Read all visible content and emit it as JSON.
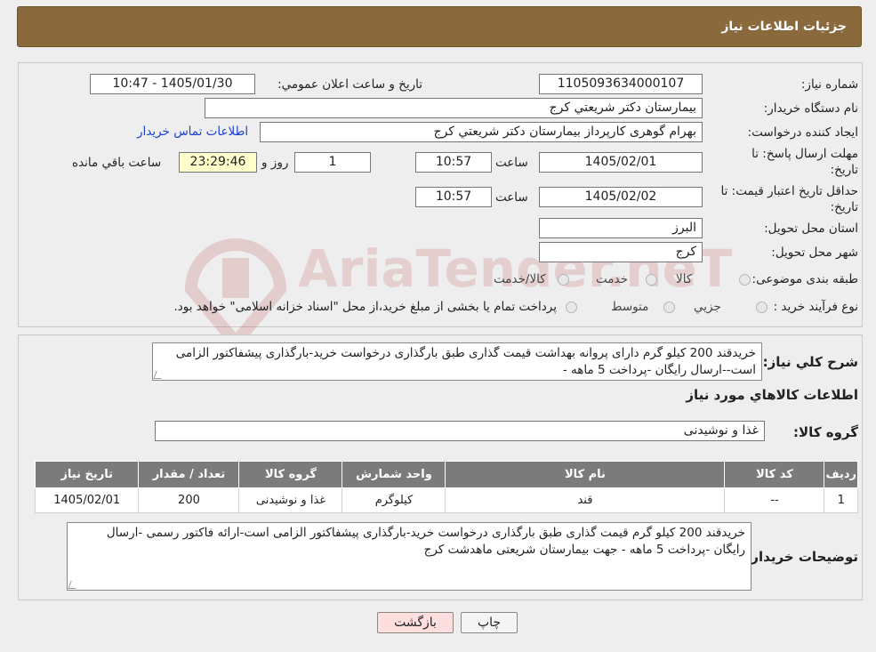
{
  "header": {
    "title": "جزئیات اطلاعات نیاز"
  },
  "form": {
    "need_number_label": "شماره نیاز:",
    "need_number": "1105093634000107",
    "announce_label": "تاریخ و ساعت اعلان عمومي:",
    "announce_value": "1405/01/30 - 10:47",
    "buyer_org_label": "نام دستگاه خريدار:",
    "buyer_org": "بيمارستان دكتر شريعتي كرج",
    "creator_label": "ايجاد كننده درخواست:",
    "creator": "بهرام گوهری کارپرداز بیمارستان دكتر شريعتي كرج",
    "contact_link": "اطلاعات تماس خريدار",
    "deadline_label_1": "مهلت ارسال پاسخ: تا",
    "deadline_label_2": "تاریخ:",
    "deadline_date": "1405/02/01",
    "time_label": "ساعت",
    "deadline_time": "10:57",
    "days_count": "1",
    "days_label": "روز و",
    "remaining_time": "23:29:46",
    "remaining_label": "ساعت باقي مانده",
    "validity_label_1": "حداقل تاريخ اعتبار قيمت: تا",
    "validity_label_2": "تاريخ:",
    "validity_date": "1405/02/02",
    "validity_time": "10:57",
    "province_label": "استان محل تحويل:",
    "province": "البرز",
    "city_label": "شهر محل تحويل:",
    "city": "كرج",
    "category_label": "طبقه بندی موضوعی:",
    "category_options": [
      "كالا",
      "خدمت",
      "كالا/خدمت"
    ],
    "process_label": "نوع فرآيند خريد :",
    "process_options": [
      "جزيي",
      "متوسط"
    ],
    "process_note": "پرداخت تمام یا بخشی از مبلغ خرید،از محل \"اسناد خزانه اسلامی\" خواهد بود."
  },
  "summary": {
    "label": "شرح كلي نياز:",
    "text": "خریدقند 200 کیلو گرم دارای پروانه بهداشت قیمت گذاری طبق بارگذاری درخواست خرید-بارگذاری پیشفاکتور الزامی است--ارسال رایگان -پرداخت 5 ماهه -",
    "items_title": "اطلاعات كالاهاي مورد نياز",
    "group_label": "گروه كالا:",
    "group_value": "غذا و نوشيدنی"
  },
  "table": {
    "headers": [
      "رديف",
      "كد كالا",
      "نام كالا",
      "واحد شمارش",
      "گروه كالا",
      "تعداد / مقدار",
      "تاريخ نياز"
    ],
    "rows": [
      [
        "1",
        "--",
        "قند",
        "كيلوگرم",
        "غذا و نوشيدنی",
        "200",
        "1405/02/01"
      ]
    ]
  },
  "notes": {
    "label": "توضيحات خريدار:",
    "text": "خریدقند 200 کیلو گرم   قیمت گذاری طبق بارگذاری درخواست خرید-بارگذاری پیشفاکتور الزامی است-ارائه فاکتور رسمی -ارسال رایگان -پرداخت 5 ماهه - جهت بیمارستان شریعتی ماهدشت کرج"
  },
  "buttons": {
    "print": "چاپ",
    "back": "بازگشت"
  },
  "watermark": {
    "text": "AriaTender.neT"
  },
  "colors": {
    "header": "#8a6a3c",
    "table_header": "#7b7b7b",
    "back_button": "#ffdede",
    "remaining": "#ffffcc",
    "link": "#1a3fd1"
  }
}
